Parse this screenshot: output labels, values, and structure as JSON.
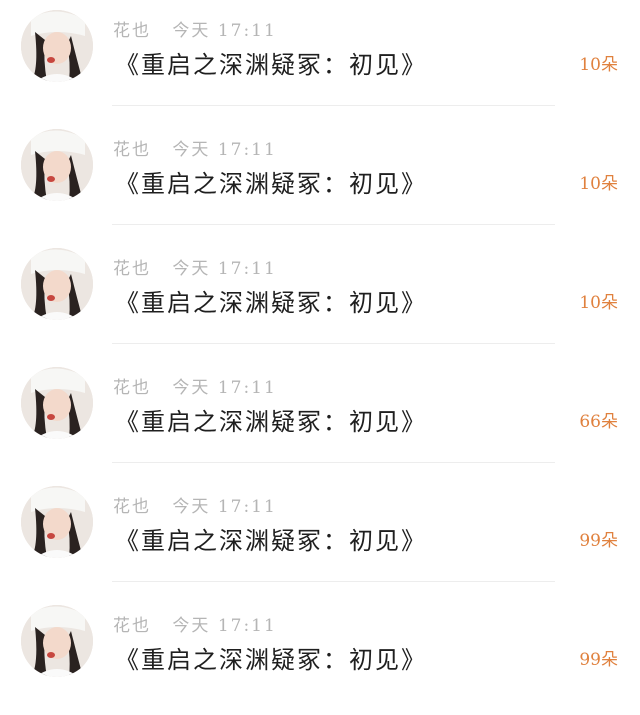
{
  "gifts": [
    {
      "sender": "花也",
      "date": "今天",
      "time": "17:11",
      "message": "《重启之深渊疑冢：初见》",
      "count": "10朵"
    },
    {
      "sender": "花也",
      "date": "今天",
      "time": "17:11",
      "message": "《重启之深渊疑冢：初见》",
      "count": "10朵"
    },
    {
      "sender": "花也",
      "date": "今天",
      "time": "17:11",
      "message": "《重启之深渊疑冢：初见》",
      "count": "10朵"
    },
    {
      "sender": "花也",
      "date": "今天",
      "time": "17:11",
      "message": "《重启之深渊疑冢：初见》",
      "count": "66朵"
    },
    {
      "sender": "花也",
      "date": "今天",
      "time": "17:11",
      "message": "《重启之深渊疑冢：初见》",
      "count": "99朵"
    },
    {
      "sender": "花也",
      "date": "今天",
      "time": "17:11",
      "message": "《重启之深渊疑冢：初见》",
      "count": "99朵"
    }
  ],
  "colors": {
    "count_accent": "#e0813e",
    "meta_gray": "#b5b5b5",
    "title_dark": "#1f1f1f"
  }
}
